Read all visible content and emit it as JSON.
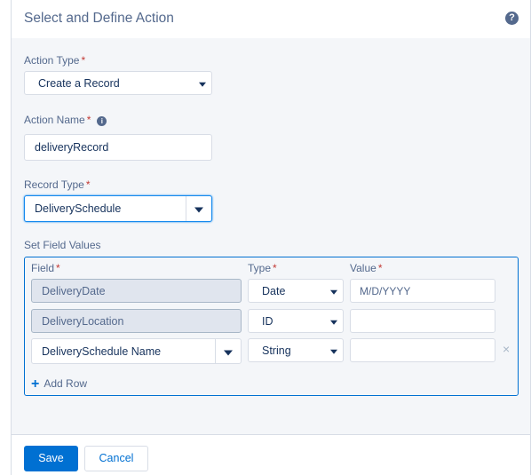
{
  "dialog": {
    "title": "Select and Define Action",
    "help_icon": "question-circle-icon",
    "help_glyph": "?"
  },
  "action_type": {
    "label": "Action Type",
    "required_mark": "*",
    "value": "Create a Record"
  },
  "action_name": {
    "label": "Action Name",
    "required_mark": "*",
    "info_glyph": "i",
    "value": "deliveryRecord"
  },
  "record_type": {
    "label": "Record Type",
    "required_mark": "*",
    "value": "DeliverySchedule"
  },
  "field_values": {
    "section_label": "Set Field Values",
    "headers": {
      "field": "Field",
      "type": "Type",
      "value": "Value",
      "required_mark": "*"
    },
    "rows": [
      {
        "field": "DeliveryDate",
        "type": "Date",
        "value": "",
        "placeholder": "M/D/YYYY"
      },
      {
        "field": "DeliveryLocation",
        "type": "ID",
        "value": "",
        "placeholder": ""
      },
      {
        "field": "DeliverySchedule Name",
        "type": "String",
        "value": "",
        "placeholder": "",
        "remove_glyph": "×"
      }
    ],
    "add_row_label": "Add Row",
    "add_glyph": "+"
  },
  "footer": {
    "save_label": "Save",
    "cancel_label": "Cancel"
  },
  "colors": {
    "brand": "#0070d2",
    "required": "#c23934",
    "text": "#16325c",
    "label": "#54698d"
  }
}
